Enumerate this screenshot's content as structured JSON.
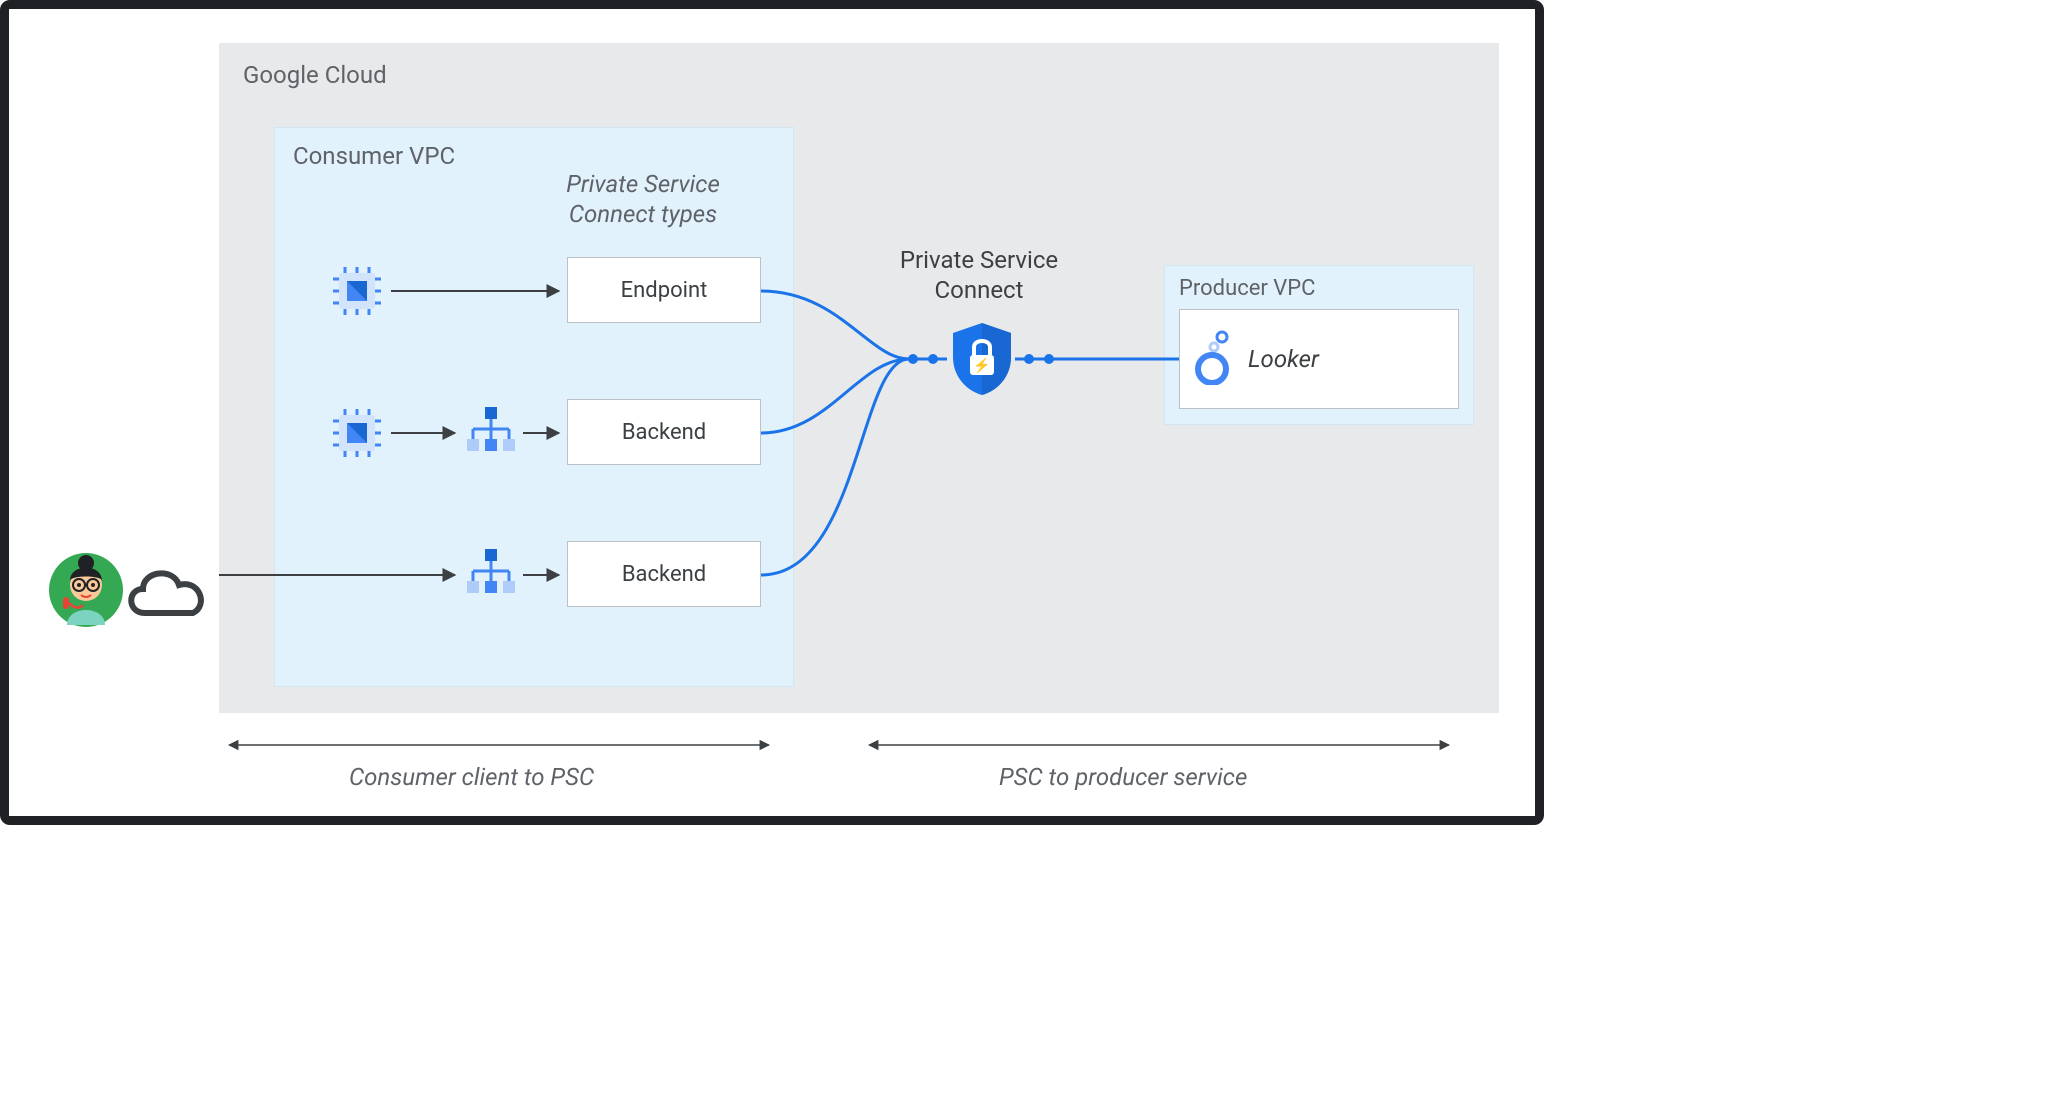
{
  "gcloud": {
    "label": "Google Cloud"
  },
  "consumer_vpc": {
    "label": "Consumer VPC"
  },
  "psc_types_heading": "Private Service\nConnect types",
  "types": {
    "endpoint": "Endpoint",
    "backend1": "Backend",
    "backend2": "Backend"
  },
  "psc": {
    "label": "Private Service\nConnect"
  },
  "producer_vpc": {
    "label": "Producer VPC"
  },
  "looker": {
    "label": "Looker"
  },
  "brackets": {
    "left": "Consumer client to PSC",
    "right": "PSC to producer service"
  },
  "icons": {
    "user": "user-avatar-icon",
    "cloud": "cloud-icon",
    "chip": "compute-chip-icon",
    "router": "load-balancer-icon",
    "shield": "psc-shield-icon",
    "looker": "looker-icon"
  },
  "colors": {
    "blue": "#1a73e8",
    "blue_fill": "#4285f4",
    "gray_text": "#5f6368",
    "dark": "#202124",
    "light_blue_bg": "#e1f2fd",
    "gray_bg": "#e8e9eb"
  }
}
